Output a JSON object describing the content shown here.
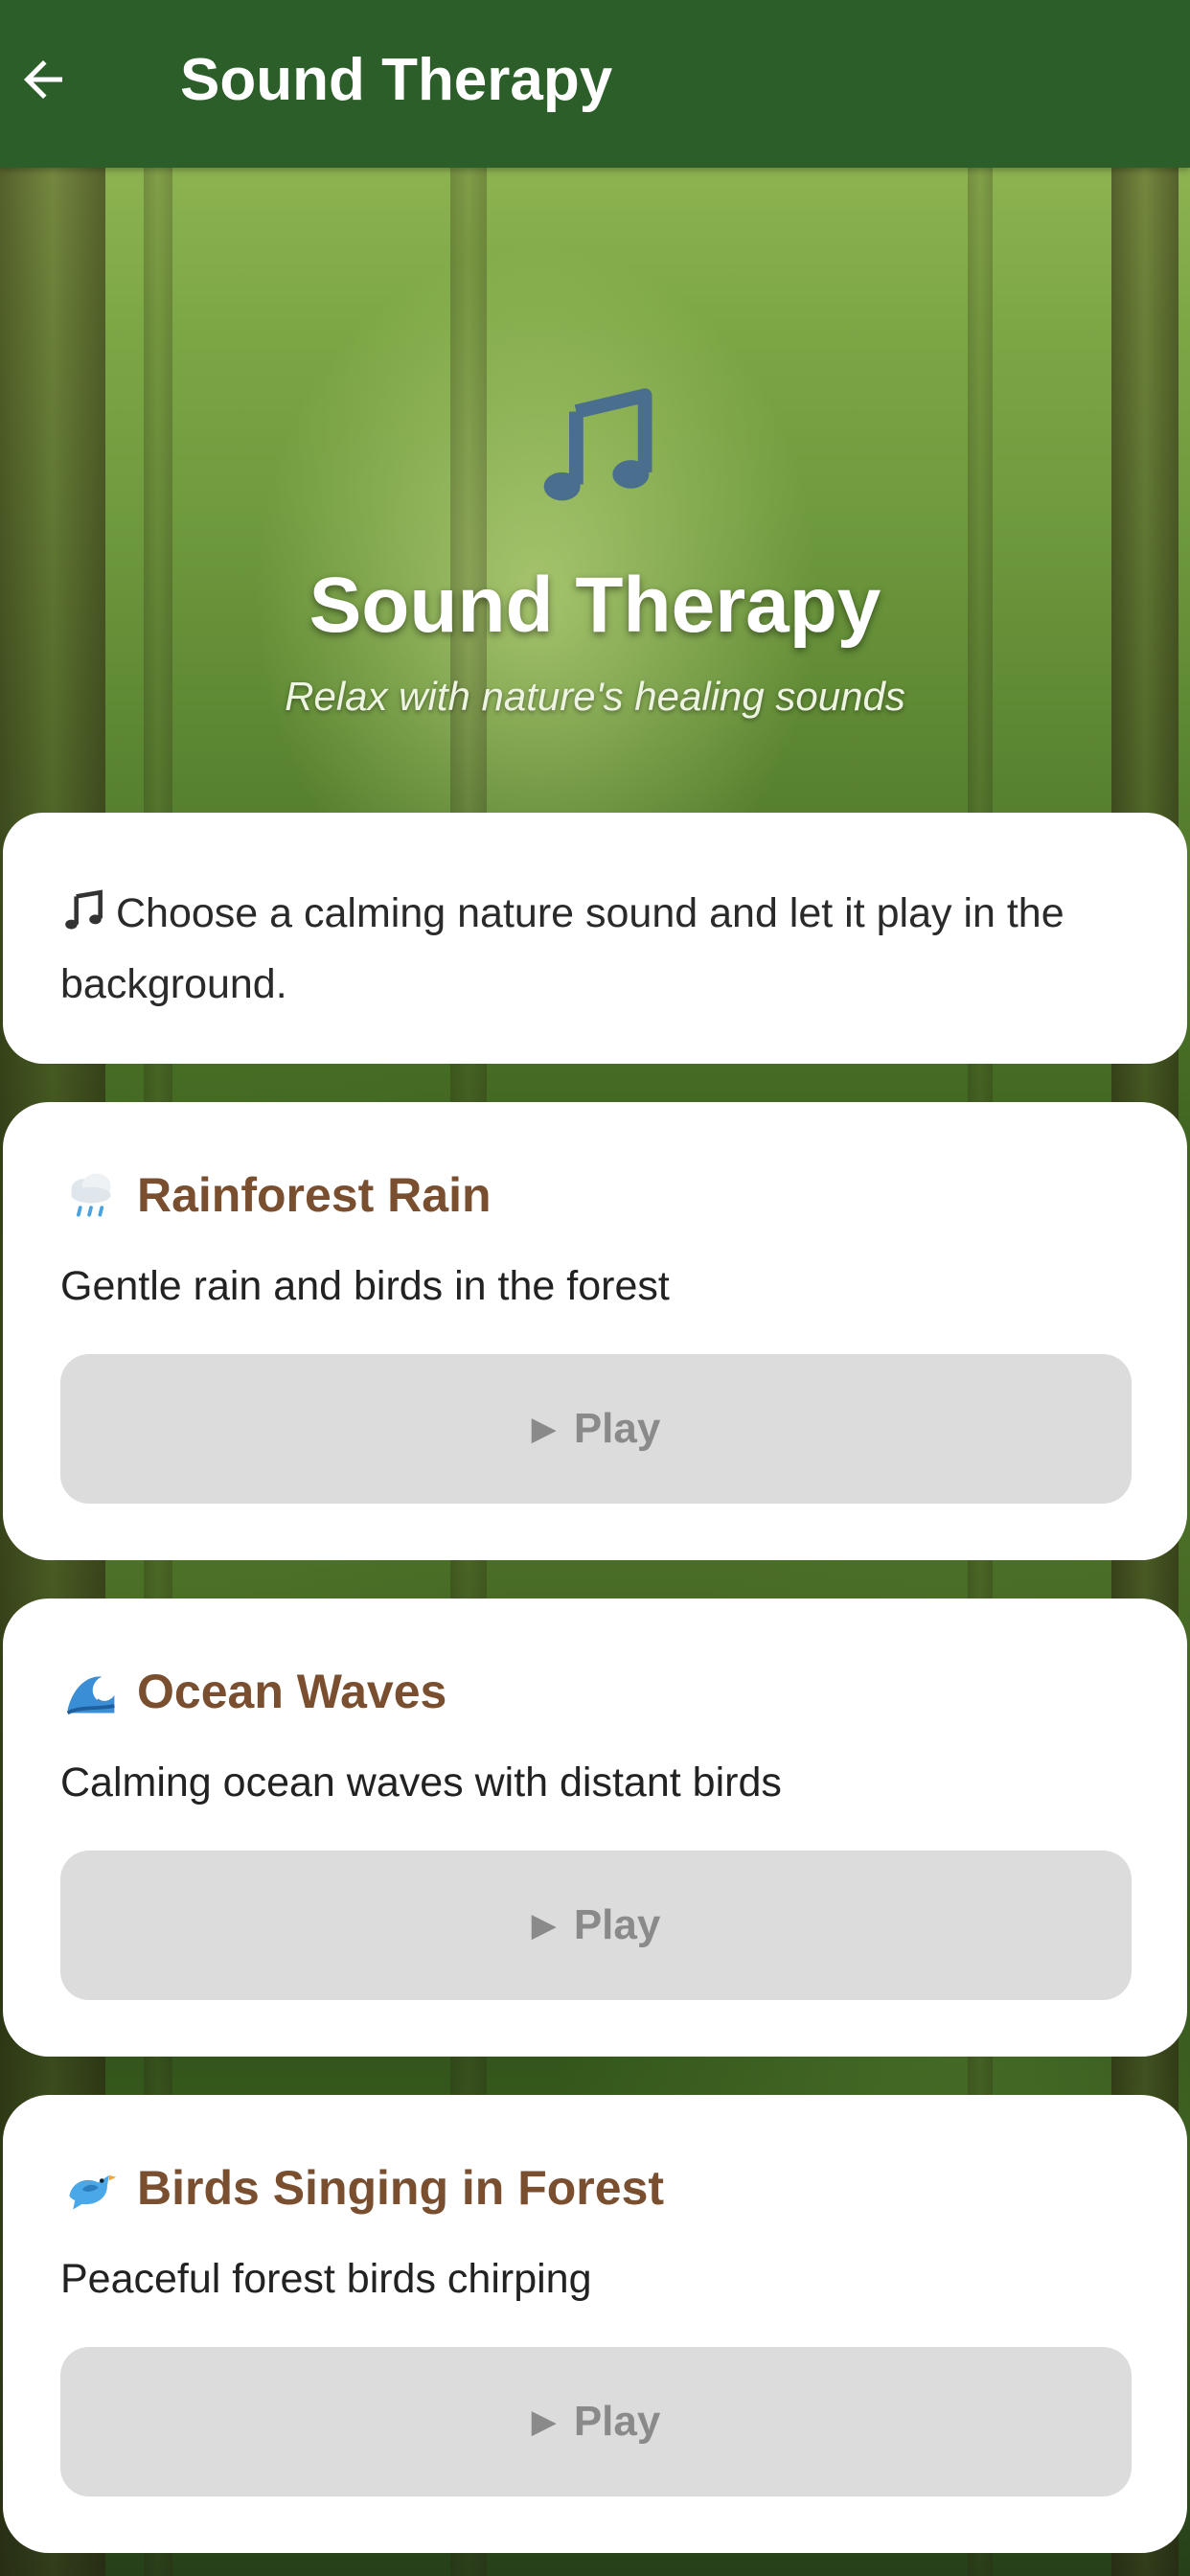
{
  "appbar": {
    "title": "Sound Therapy"
  },
  "hero": {
    "title": "Sound Therapy",
    "subtitle": "Relax with nature's healing sounds",
    "icon": "music-notes-icon"
  },
  "info": {
    "text": "Choose a calming nature sound and let it play in the background."
  },
  "sounds": [
    {
      "title": "Rainforest Rain",
      "icon": "rain-cloud-icon",
      "description": "Gentle rain and birds in the forest",
      "button_label": "Play"
    },
    {
      "title": "Ocean Waves",
      "icon": "wave-icon",
      "description": "Calming ocean waves with distant birds",
      "button_label": "Play"
    },
    {
      "title": "Birds Singing in Forest",
      "icon": "bird-icon",
      "description": "Peaceful forest birds chirping",
      "button_label": "Play"
    }
  ],
  "colors": {
    "appbar": "#2c5e2a",
    "card_title": "#7a4f30",
    "play_button_bg": "#dcdcdc",
    "play_button_text": "#8a8a8a",
    "hero_icon": "#4a6f8e"
  }
}
